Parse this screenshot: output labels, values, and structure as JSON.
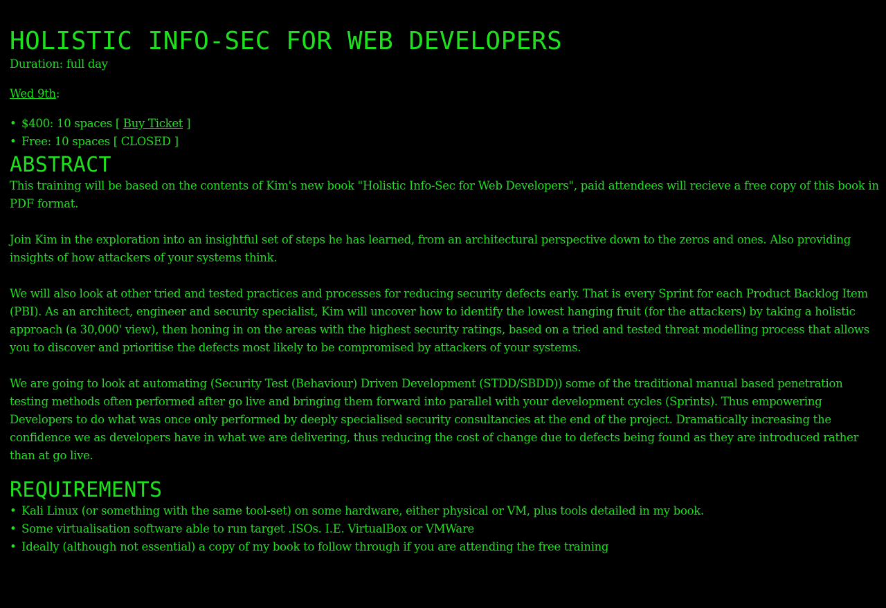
{
  "title": "HOLISTIC INFO-SEC FOR WEB DEVELOPERS",
  "duration": "Duration: full day",
  "date": {
    "label": "Wed 9th",
    "suffix": ":"
  },
  "tickets": [
    {
      "prefix": "$400: 10 spaces [ ",
      "link_label": "Buy Ticket",
      "suffix": " ]"
    },
    {
      "text": "Free: 10 spaces [ CLOSED ]"
    }
  ],
  "abstract": {
    "heading": "ABSTRACT",
    "paragraphs": [
      "This training will be based on the contents of Kim's new book \"Holistic Info-Sec for Web Developers\", paid attendees will recieve a free copy of this book in PDF format.",
      "Join Kim in the exploration into an insightful set of steps he has learned, from an architectural perspective down to the zeros and ones. Also providing insights of how attackers of your systems think.",
      "We will also look at other tried and tested practices and processes for reducing security defects early. That is every Sprint for each Product Backlog Item (PBI). As an architect, engineer and security specialist, Kim will uncover how to identify the lowest hanging fruit (for the attackers) by taking a holistic approach (a 30,000' view), then honing in on the areas with the highest security ratings, based on a tried and tested threat modelling process that allows you to discover and prioritise the defects most likely to be compromised by attackers of your systems.",
      "We are going to look at automating (Security Test (Behaviour) Driven Development (STDD/SBDD)) some of the traditional manual based penetration testing methods often performed after go live and bringing them forward into parallel with your development cycles (Sprints). Thus empowering Developers to do what was once only performed by deeply specialised security consultancies at the end of the project. Dramatically increasing the confidence we as developers have in what we are delivering, thus reducing the cost of change due to defects being found as they are introduced rather than at go live."
    ]
  },
  "requirements": {
    "heading": "REQUIREMENTS",
    "items": [
      "Kali Linux (or something with the same tool-set) on some hardware, either physical or VM, plus tools detailed in my book.",
      "Some virtualisation software able to run target .ISOs. I.E. VirtualBox or VMWare",
      "Ideally (although not essential) a copy of my book to follow through if you are attending the free training"
    ]
  },
  "colors": {
    "background": "#000000",
    "text": "#1fe01f"
  }
}
